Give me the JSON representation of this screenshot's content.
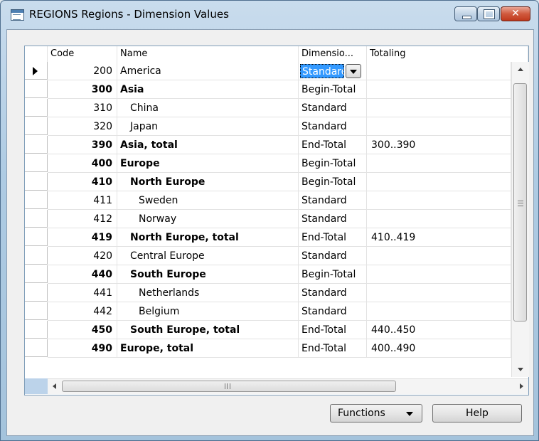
{
  "window": {
    "title": "REGIONS Regions - Dimension Values",
    "close_glyph": "✕"
  },
  "columns": {
    "code": "Code",
    "name": "Name",
    "dimension_type": "Dimensio...",
    "totaling": "Totaling"
  },
  "rows": [
    {
      "code": "200",
      "name": "America",
      "type": "Standard",
      "totaling": "",
      "bold": false,
      "indent": 0,
      "current": true
    },
    {
      "code": "300",
      "name": "Asia",
      "type": "Begin-Total",
      "totaling": "",
      "bold": true,
      "indent": 0
    },
    {
      "code": "310",
      "name": "China",
      "type": "Standard",
      "totaling": "",
      "bold": false,
      "indent": 1
    },
    {
      "code": "320",
      "name": "Japan",
      "type": "Standard",
      "totaling": "",
      "bold": false,
      "indent": 1
    },
    {
      "code": "390",
      "name": "Asia, total",
      "type": "End-Total",
      "totaling": "300..390",
      "bold": true,
      "indent": 0
    },
    {
      "code": "400",
      "name": "Europe",
      "type": "Begin-Total",
      "totaling": "",
      "bold": true,
      "indent": 0
    },
    {
      "code": "410",
      "name": "North Europe",
      "type": "Begin-Total",
      "totaling": "",
      "bold": true,
      "indent": 1
    },
    {
      "code": "411",
      "name": "Sweden",
      "type": "Standard",
      "totaling": "",
      "bold": false,
      "indent": 2
    },
    {
      "code": "412",
      "name": "Norway",
      "type": "Standard",
      "totaling": "",
      "bold": false,
      "indent": 2
    },
    {
      "code": "419",
      "name": "North Europe, total",
      "type": "End-Total",
      "totaling": "410..419",
      "bold": true,
      "indent": 1
    },
    {
      "code": "420",
      "name": "Central Europe",
      "type": "Standard",
      "totaling": "",
      "bold": false,
      "indent": 1
    },
    {
      "code": "440",
      "name": "South Europe",
      "type": "Begin-Total",
      "totaling": "",
      "bold": true,
      "indent": 1
    },
    {
      "code": "441",
      "name": "Netherlands",
      "type": "Standard",
      "totaling": "",
      "bold": false,
      "indent": 2
    },
    {
      "code": "442",
      "name": "Belgium",
      "type": "Standard",
      "totaling": "",
      "bold": false,
      "indent": 2
    },
    {
      "code": "450",
      "name": "South Europe, total",
      "type": "End-Total",
      "totaling": "440..450",
      "bold": true,
      "indent": 1
    },
    {
      "code": "490",
      "name": "Europe, total",
      "type": "End-Total",
      "totaling": "400..490",
      "bold": true,
      "indent": 0
    }
  ],
  "current_cell_value": "Standard",
  "buttons": {
    "functions": "Functions",
    "help": "Help"
  },
  "icons": {
    "window": "table-window-icon",
    "row_selector": "current-row-triangle-icon",
    "dropdown": "chevron-down-icon"
  }
}
